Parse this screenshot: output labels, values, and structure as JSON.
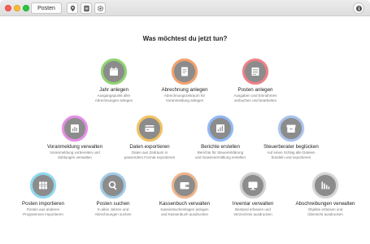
{
  "toolbar": {
    "posten_label": "Posten"
  },
  "heading": "Was möchtest du jetzt tun?",
  "cards": [
    {
      "title": "Jahr anlegen",
      "desc1": "Ausgangspunkt aller",
      "desc2": "Abrechnungen anlegen",
      "ring": "#8fd36e",
      "icon": "calendar-icon"
    },
    {
      "title": "Abrechnung anlegen",
      "desc1": "Abrechnungszeitraum für",
      "desc2": "Voranmeldung anlegen",
      "ring": "#f3a06a",
      "icon": "document-icon"
    },
    {
      "title": "Posten anlegen",
      "desc1": "Ausgaben und Einnahmen",
      "desc2": "verbuchen und bearbeiten",
      "ring": "#ef7f86",
      "icon": "list-icon"
    },
    {
      "title": "Voranmeldung verwalten",
      "desc1": "Voranmeldung vorbereiten und",
      "desc2": "Zahlungen verwalten",
      "ring": "#e58de6",
      "icon": "report-icon"
    },
    {
      "title": "Daten exportieren",
      "desc1": "Daten aus Zeitraum in",
      "desc2": "passendem Format exportieren",
      "ring": "#f3c15f",
      "icon": "export-icon"
    },
    {
      "title": "Berichte erstellen",
      "desc1": "Berichte für Steuererklärung",
      "desc2": "und Gewinnermittlung erstellen",
      "ring": "#8fb8f6",
      "icon": "chart-icon"
    },
    {
      "title": "Steuerberater beglücken",
      "desc1": "Auf einen Schlag alle Dateien",
      "desc2": "bündeln und exportieren",
      "ring": "#a9c3ef",
      "icon": "archive-icon"
    },
    {
      "title": "Posten importieren",
      "desc1": "Posten aus anderen",
      "desc2": "Programmen importieren",
      "ring": "#8fd8ef",
      "icon": "table-icon"
    },
    {
      "title": "Posten suchen",
      "desc1": "In allen Jahren und",
      "desc2": "Abrechnungen suchen",
      "ring": "#9fcbe9",
      "icon": "search-icon"
    },
    {
      "title": "Kassenbuch verwalten",
      "desc1": "Kassenbucheinlagen anlegen",
      "desc2": "und Kassenbuch ausdrucken",
      "ring": "#efb48a",
      "icon": "wallet-icon"
    },
    {
      "title": "Inventar verwalten",
      "desc1": "Bestand erfassen und",
      "desc2": "Verzeichnis ausdrucken",
      "ring": "#cfcfcf",
      "icon": "monitor-icon"
    },
    {
      "title": "Abschreibungen verwalten",
      "desc1": "Objekte erfassen und",
      "desc2": "Übersicht ausdrucken",
      "ring": "#d4d4d4",
      "icon": "bars-down-icon"
    }
  ]
}
